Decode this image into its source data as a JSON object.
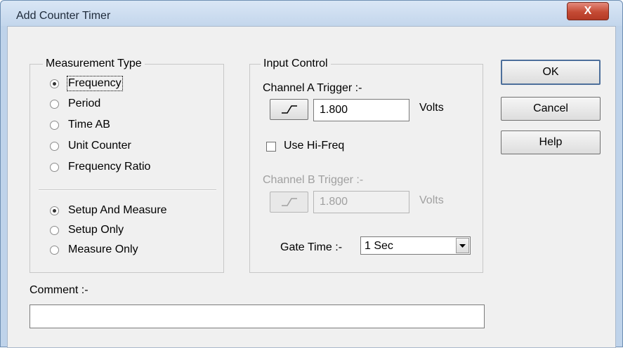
{
  "window": {
    "title": "Add Counter Timer",
    "close_glyph": "X"
  },
  "measurement_type": {
    "legend": "Measurement Type",
    "options": [
      "Frequency",
      "Period",
      "Time AB",
      "Unit Counter",
      "Frequency Ratio"
    ],
    "selected": "Frequency",
    "modes": [
      "Setup And Measure",
      "Setup Only",
      "Measure Only"
    ],
    "selected_mode": "Setup And Measure"
  },
  "input_control": {
    "legend": "Input Control",
    "channel_a_label": "Channel A Trigger :-",
    "channel_a_value": "1.800",
    "channel_a_units": "Volts",
    "hi_freq_label": "Use Hi-Freq",
    "hi_freq_checked": false,
    "channel_b_label": "Channel B Trigger :-",
    "channel_b_value": "1.800",
    "channel_b_units": "Volts",
    "gate_time_label": "Gate Time :-",
    "gate_time_value": "1 Sec"
  },
  "buttons": {
    "ok": "OK",
    "cancel": "Cancel",
    "help": "Help"
  },
  "comment": {
    "label": "Comment :-",
    "value": ""
  }
}
